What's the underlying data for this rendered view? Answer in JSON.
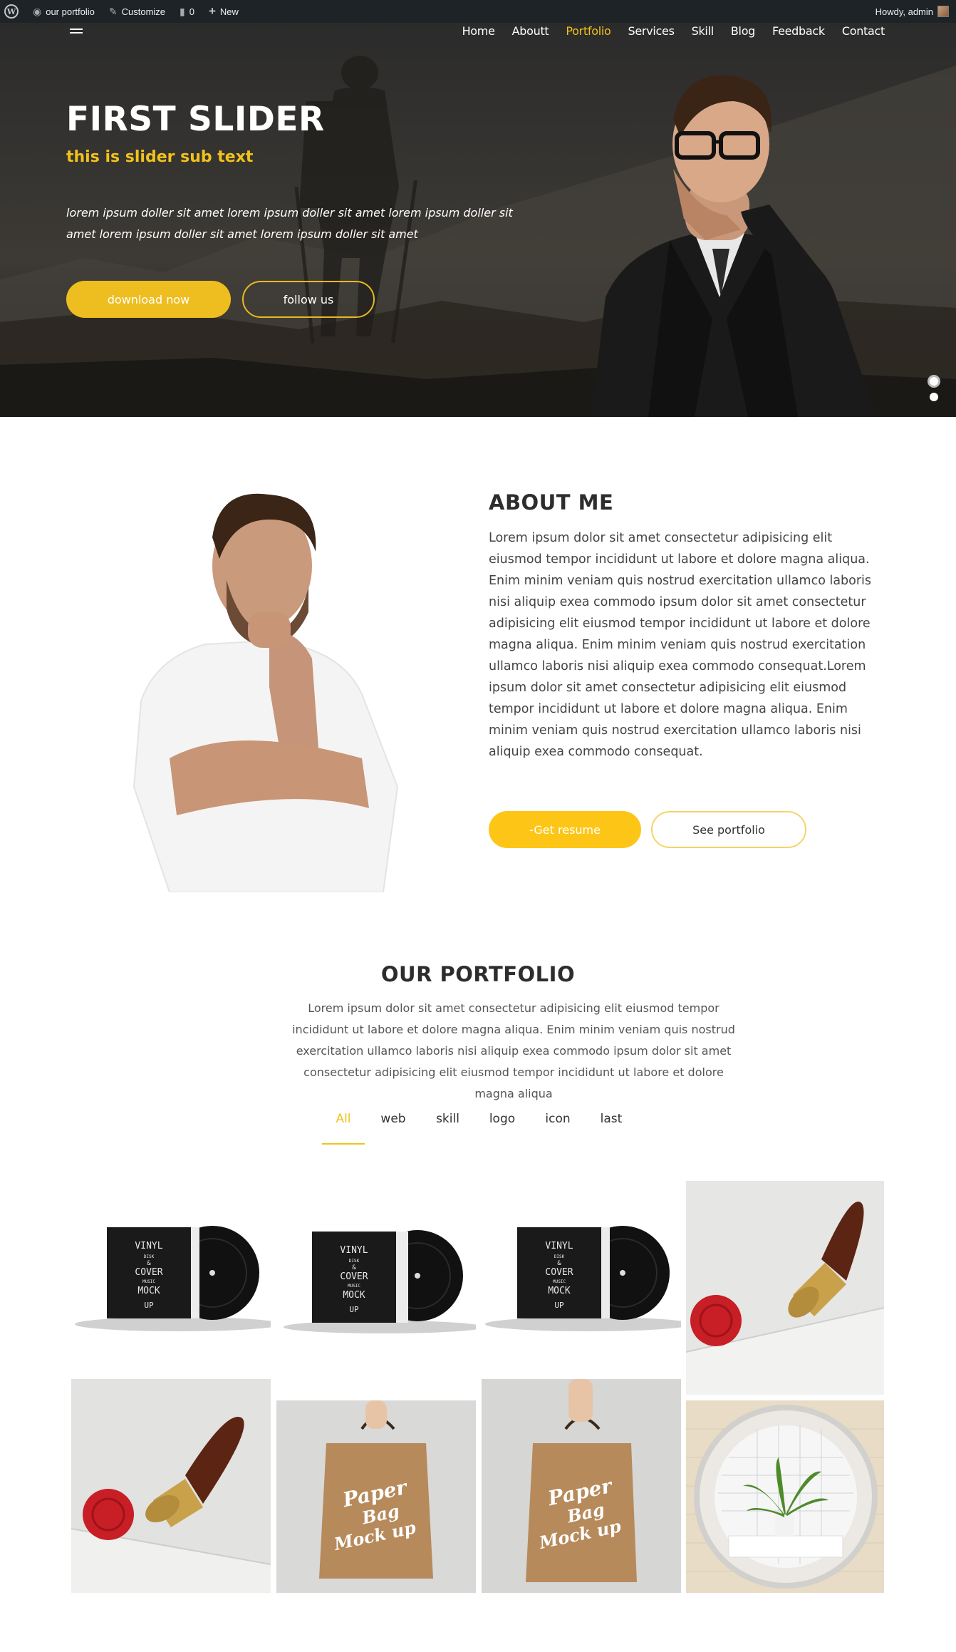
{
  "admin_bar": {
    "site_name": "our portfolio",
    "customize": "Customize",
    "comments_count": "0",
    "new": "New",
    "howdy": "Howdy, admin"
  },
  "nav": {
    "items": [
      {
        "label": "Home",
        "active": false
      },
      {
        "label": "Aboutt",
        "active": false
      },
      {
        "label": "Portfolio",
        "active": true
      },
      {
        "label": "Services",
        "active": false
      },
      {
        "label": "Skill",
        "active": false
      },
      {
        "label": "Blog",
        "active": false
      },
      {
        "label": "Feedback",
        "active": false
      },
      {
        "label": "Contact",
        "active": false
      }
    ]
  },
  "hero": {
    "title": "FIRST SLIDER",
    "subtitle": "this is slider sub text",
    "text": "lorem ipsum doller sit amet lorem ipsum doller sit amet lorem ipsum doller sit amet lorem ipsum doller sit amet lorem ipsum doller sit amet",
    "primary_button": "download now",
    "secondary_button": "follow us",
    "slides_total": 2,
    "active_slide": 1
  },
  "about": {
    "title": "ABOUT ME",
    "text": "Lorem ipsum dolor sit amet consectetur adipisicing elit eiusmod tempor incididunt ut labore et dolore magna aliqua. Enim minim veniam quis nostrud exercitation ullamco laboris nisi aliquip exea commodo ipsum dolor sit amet consectetur adipisicing elit eiusmod tempor incididunt ut labore et dolore magna aliqua. Enim minim veniam quis nostrud exercitation ullamco laboris nisi aliquip exea commodo consequat.Lorem ipsum dolor sit amet consectetur adipisicing elit eiusmod tempor incididunt ut labore et dolore magna aliqua. Enim minim veniam quis nostrud exercitation ullamco laboris nisi aliquip exea commodo consequat.",
    "resume_button": "-Get resume",
    "portfolio_button": "See portfolio"
  },
  "portfolio": {
    "title": "OUR PORTFOLIO",
    "text": "Lorem ipsum dolor sit amet consectetur adipisicing elit eiusmod tempor incididunt ut labore et dolore magna aliqua. Enim minim veniam quis nostrud exercitation ullamco laboris nisi aliquip exea commodo ipsum dolor sit amet consectetur adipisicing elit eiusmod tempor incididunt ut labore et dolore magna aliqua",
    "filters": [
      {
        "label": "All",
        "active": true
      },
      {
        "label": "web",
        "active": false
      },
      {
        "label": "skill",
        "active": false
      },
      {
        "label": "logo",
        "active": false
      },
      {
        "label": "icon",
        "active": false
      },
      {
        "label": "last",
        "active": false
      }
    ],
    "vinyl_text": [
      "VINYL",
      "DISK",
      "&",
      "COVER",
      "MUSIC",
      "MOCK",
      "UP"
    ],
    "bag_text": [
      "Paper",
      "Bag",
      "Mock up"
    ]
  },
  "colors": {
    "accent": "#f1c21b",
    "admin_bar": "#1d2327"
  }
}
